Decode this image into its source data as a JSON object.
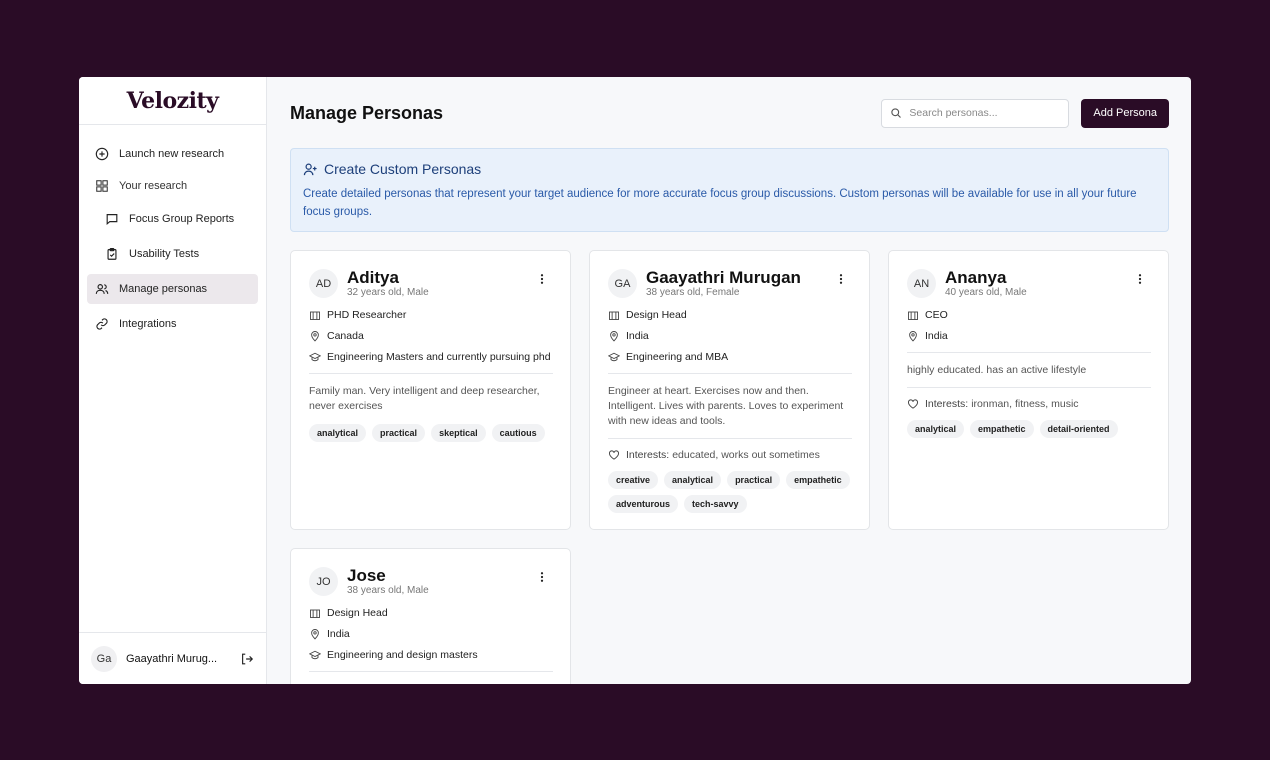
{
  "brand": {
    "logo_text": "Velozity"
  },
  "sidebar": {
    "items": [
      {
        "label": "Launch new research",
        "icon": "plus-circle-icon"
      },
      {
        "label": "Your research",
        "icon": "grid-icon"
      },
      {
        "label": "Focus Group Reports",
        "icon": "chat-icon"
      },
      {
        "label": "Usability Tests",
        "icon": "clipboard-icon"
      },
      {
        "label": "Manage personas",
        "icon": "users-icon",
        "active": true
      },
      {
        "label": "Integrations",
        "icon": "link-icon"
      }
    ],
    "user": {
      "initials": "Ga",
      "name": "Gaayathri Murug..."
    }
  },
  "header": {
    "title": "Manage Personas",
    "search_placeholder": "Search personas...",
    "add_button": "Add Persona"
  },
  "banner": {
    "title": "Create Custom Personas",
    "text": "Create detailed personas that represent your target audience for more accurate focus group discussions. Custom personas will be available for use in all your future focus groups."
  },
  "colors": {
    "accent": "#2a0c26",
    "banner_bg": "#e9f1fb",
    "banner_text": "#2a5aa8"
  },
  "personas": [
    {
      "initials": "AD",
      "name": "Aditya",
      "meta": "32 years old, Male",
      "role": "PHD Researcher",
      "location": "Canada",
      "education": "Engineering Masters and currently pursuing phd",
      "description": "Family man. Very intelligent and deep researcher, never exercises",
      "interests_label": "",
      "interests": "",
      "tags": [
        "analytical",
        "practical",
        "skeptical",
        "cautious"
      ]
    },
    {
      "initials": "GA",
      "name": "Gaayathri Murugan",
      "meta": "38 years old, Female",
      "role": "Design Head",
      "location": "India",
      "education": "Engineering and MBA",
      "description": "Engineer at heart. Exercises now and then. Intelligent. Lives with parents. Loves to experiment with new ideas and tools.",
      "interests_label": "Interests:",
      "interests": "educated, works out sometimes",
      "tags": [
        "creative",
        "analytical",
        "practical",
        "empathetic",
        "adventurous",
        "tech-savvy"
      ]
    },
    {
      "initials": "AN",
      "name": "Ananya",
      "meta": "40 years old, Male",
      "role": "CEO",
      "location": "India",
      "education": "",
      "description": "highly educated. has an active lifestyle",
      "interests_label": "Interests:",
      "interests": "ironman, fitness, music",
      "tags": [
        "analytical",
        "empathetic",
        "detail-oriented"
      ]
    },
    {
      "initials": "JO",
      "name": "Jose",
      "meta": "38 years old, Male",
      "role": "Design Head",
      "location": "India",
      "education": "Engineering and design masters",
      "description": "",
      "interests_label": "",
      "interests": "",
      "tags": []
    }
  ]
}
